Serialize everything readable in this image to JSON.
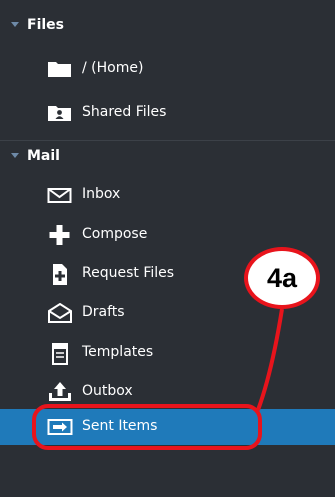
{
  "files": {
    "header": "Files",
    "items": [
      {
        "label": "/ (Home)",
        "icon": "folder-icon"
      },
      {
        "label": "Shared Files",
        "icon": "shared-folder-icon"
      }
    ]
  },
  "mail": {
    "header": "Mail",
    "items": [
      {
        "label": "Inbox",
        "icon": "envelope-icon"
      },
      {
        "label": "Compose",
        "icon": "plus-icon"
      },
      {
        "label": "Request Files",
        "icon": "request-file-icon"
      },
      {
        "label": "Drafts",
        "icon": "open-envelope-icon"
      },
      {
        "label": "Templates",
        "icon": "template-icon"
      },
      {
        "label": "Outbox",
        "icon": "outbox-icon"
      },
      {
        "label": "Sent Items",
        "icon": "sent-items-icon"
      }
    ],
    "selected": "Sent Items"
  },
  "annotation": {
    "callout": "4a",
    "color": "#e8141c"
  },
  "colors": {
    "background": "#2b2f35",
    "selected": "#1f7aba",
    "triangle": "#6e8aa8"
  }
}
